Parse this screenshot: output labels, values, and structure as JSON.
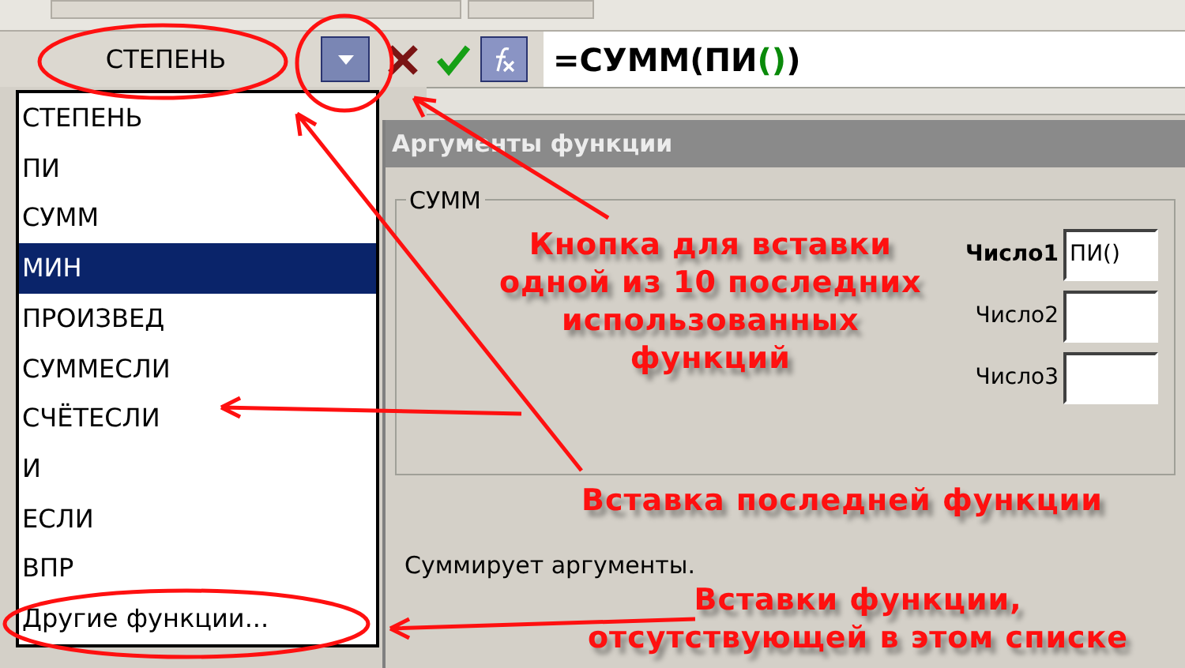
{
  "name_box": {
    "value": "СТЕПЕНЬ"
  },
  "formula": {
    "before": "=СУММ(ПИ",
    "highlight": "()",
    "after": ")"
  },
  "function_list": [
    {
      "label": "СТЕПЕНЬ",
      "selected": false
    },
    {
      "label": "ПИ",
      "selected": false
    },
    {
      "label": "СУММ",
      "selected": false
    },
    {
      "label": "МИН",
      "selected": true
    },
    {
      "label": "ПРОИЗВЕД",
      "selected": false
    },
    {
      "label": "СУММЕСЛИ",
      "selected": false
    },
    {
      "label": "СЧЁТЕСЛИ",
      "selected": false
    },
    {
      "label": "И",
      "selected": false
    },
    {
      "label": "ЕСЛИ",
      "selected": false
    },
    {
      "label": "ВПР",
      "selected": false
    },
    {
      "label": "Другие функции...",
      "selected": false
    }
  ],
  "dialog": {
    "title": "Аргументы функции",
    "group": "СУММ",
    "arguments": [
      {
        "label": "Число1",
        "value": "ПИ()",
        "bold": true
      },
      {
        "label": "Число2",
        "bold": false
      },
      {
        "label": "Число3",
        "bold": false
      }
    ],
    "description": "Суммирует аргументы."
  },
  "annotations": [
    "Кнопка для вставки\nодной из 10 последних\nиспользованных\nфункций",
    "Вставка последней функции",
    "Вставки функции,\nотсутствующей в этом списке"
  ]
}
